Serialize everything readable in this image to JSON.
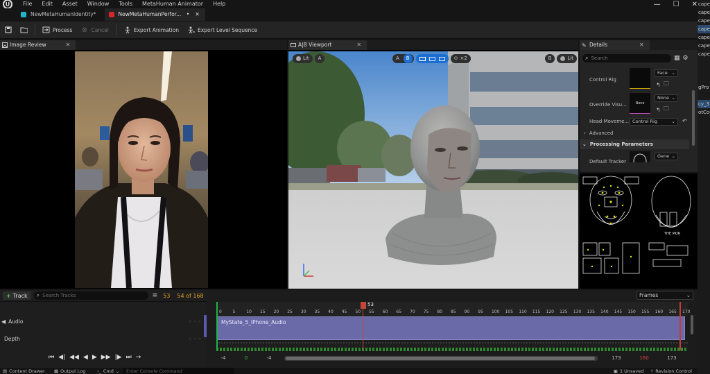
{
  "menu": {
    "items": [
      "File",
      "Edit",
      "Asset",
      "Window",
      "Tools",
      "MetaHuman Animator",
      "Help"
    ]
  },
  "tabs": [
    {
      "label": "NewMetaHumanIdentity*",
      "color": "#1bb6c9",
      "active": false
    },
    {
      "label": "NewMetaHumanPerfor...",
      "color": "#d9262b",
      "active": true,
      "modified": "•"
    }
  ],
  "toolbar": {
    "process_label": "Process",
    "cancel_label": "Cancel",
    "export_animation_label": "Export Animation",
    "export_level_sequence_label": "Export Level Sequence"
  },
  "panels": {
    "image_review": "Image Review",
    "viewport": "A|B Viewport",
    "details": "Details"
  },
  "viewport": {
    "left_lit": "Lit",
    "left_a": "A",
    "ab_a": "A",
    "ab_b": "B",
    "layout_x2": "×2",
    "right_b": "B",
    "right_lit": "Lit"
  },
  "details": {
    "search_placeholder": "Search",
    "control_rig_label": "Control Rig",
    "control_rig_value": "Face",
    "override_visual_label": "Override Visu...",
    "override_thumb_text": "None",
    "override_value": "None",
    "head_movement_label": "Head Moveme...",
    "head_movement_value": "Control Rig",
    "advanced_label": "Advanced",
    "processing_params_label": "Processing Parameters",
    "default_tracker_label": "Default Tracker",
    "default_tracker_value": "Gene"
  },
  "right_strip": [
    "cape",
    "cape",
    "cape",
    "cape",
    "cape",
    "cape",
    "cape",
    "",
    "",
    "",
    "gPro",
    "",
    "cy_3",
    "otCon"
  ],
  "sequencer": {
    "add_track_label": "Track",
    "search_placeholder": "Search Tracks",
    "current_frame": "53",
    "frame_count": "54 of 168",
    "playhead_label": "53",
    "frames_dropdown": "Frames",
    "tracks": [
      {
        "label": "Audio"
      },
      {
        "label": "Depth"
      }
    ],
    "clip_label": "MyState_5_iPhone_Audio",
    "ruler_ticks": [
      "0",
      "5",
      "10",
      "15",
      "20",
      "25",
      "30",
      "35",
      "40",
      "45",
      "50",
      "55",
      "60",
      "65",
      "70",
      "75",
      "80",
      "85",
      "90",
      "95",
      "100",
      "105",
      "110",
      "115",
      "120",
      "125",
      "130",
      "135",
      "140",
      "145",
      "150",
      "155",
      "160",
      "165",
      "170"
    ],
    "start_neg": "-4",
    "start_zero": "0",
    "start_neg2": "-4",
    "end_173": "173",
    "end_red": "160",
    "end_173b": "173"
  },
  "statusbar": {
    "content_drawer": "Content Drawer",
    "output_log": "Output Log",
    "cmd": "Cmd",
    "console_placeholder": "Enter Console Command",
    "unsaved": "1 Unsaved",
    "revision_control": "Revision Control"
  }
}
